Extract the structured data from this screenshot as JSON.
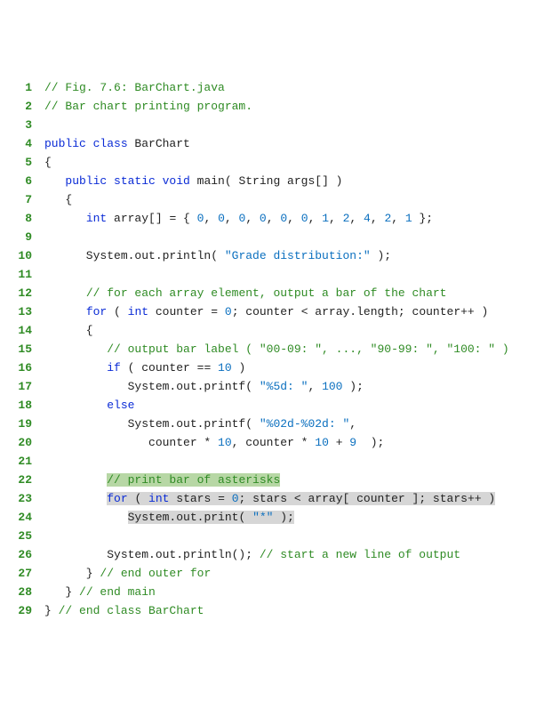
{
  "lines": [
    {
      "n": "1",
      "tokens": [
        {
          "c": "cmt",
          "t": "// Fig. 7.6: BarChart.java"
        }
      ]
    },
    {
      "n": "2",
      "tokens": [
        {
          "c": "cmt",
          "t": "// Bar chart printing program."
        }
      ]
    },
    {
      "n": "3",
      "tokens": [
        {
          "c": "pln",
          "t": ""
        }
      ]
    },
    {
      "n": "4",
      "tokens": [
        {
          "c": "kw",
          "t": "public class "
        },
        {
          "c": "pln",
          "t": "BarChart"
        }
      ]
    },
    {
      "n": "5",
      "tokens": [
        {
          "c": "pln",
          "t": "{"
        }
      ]
    },
    {
      "n": "6",
      "tokens": [
        {
          "c": "pln",
          "t": "   "
        },
        {
          "c": "kw",
          "t": "public static void "
        },
        {
          "c": "pln",
          "t": "main( String args[] )"
        }
      ]
    },
    {
      "n": "7",
      "tokens": [
        {
          "c": "pln",
          "t": "   {"
        }
      ]
    },
    {
      "n": "8",
      "tokens": [
        {
          "c": "pln",
          "t": "      "
        },
        {
          "c": "kw",
          "t": "int "
        },
        {
          "c": "pln",
          "t": "array[] = { "
        },
        {
          "c": "num",
          "t": "0"
        },
        {
          "c": "pln",
          "t": ", "
        },
        {
          "c": "num",
          "t": "0"
        },
        {
          "c": "pln",
          "t": ", "
        },
        {
          "c": "num",
          "t": "0"
        },
        {
          "c": "pln",
          "t": ", "
        },
        {
          "c": "num",
          "t": "0"
        },
        {
          "c": "pln",
          "t": ", "
        },
        {
          "c": "num",
          "t": "0"
        },
        {
          "c": "pln",
          "t": ", "
        },
        {
          "c": "num",
          "t": "0"
        },
        {
          "c": "pln",
          "t": ", "
        },
        {
          "c": "num",
          "t": "1"
        },
        {
          "c": "pln",
          "t": ", "
        },
        {
          "c": "num",
          "t": "2"
        },
        {
          "c": "pln",
          "t": ", "
        },
        {
          "c": "num",
          "t": "4"
        },
        {
          "c": "pln",
          "t": ", "
        },
        {
          "c": "num",
          "t": "2"
        },
        {
          "c": "pln",
          "t": ", "
        },
        {
          "c": "num",
          "t": "1"
        },
        {
          "c": "pln",
          "t": " };"
        }
      ]
    },
    {
      "n": "9",
      "tokens": [
        {
          "c": "pln",
          "t": ""
        }
      ]
    },
    {
      "n": "10",
      "tokens": [
        {
          "c": "pln",
          "t": "      System.out.println( "
        },
        {
          "c": "str",
          "t": "\"Grade distribution:\""
        },
        {
          "c": "pln",
          "t": " );"
        }
      ]
    },
    {
      "n": "11",
      "tokens": [
        {
          "c": "pln",
          "t": ""
        }
      ]
    },
    {
      "n": "12",
      "tokens": [
        {
          "c": "pln",
          "t": "      "
        },
        {
          "c": "cmt",
          "t": "// for each array element, output a bar of the chart"
        }
      ]
    },
    {
      "n": "13",
      "tokens": [
        {
          "c": "pln",
          "t": "      "
        },
        {
          "c": "kw",
          "t": "for "
        },
        {
          "c": "pln",
          "t": "( "
        },
        {
          "c": "kw",
          "t": "int "
        },
        {
          "c": "pln",
          "t": "counter = "
        },
        {
          "c": "num",
          "t": "0"
        },
        {
          "c": "pln",
          "t": "; counter < array.length; counter++ )"
        }
      ]
    },
    {
      "n": "14",
      "tokens": [
        {
          "c": "pln",
          "t": "      {"
        }
      ]
    },
    {
      "n": "15",
      "tokens": [
        {
          "c": "pln",
          "t": "         "
        },
        {
          "c": "cmt",
          "t": "// output bar label ( \"00-09: \", ..., \"90-99: \", \"100: \" )"
        }
      ]
    },
    {
      "n": "16",
      "tokens": [
        {
          "c": "pln",
          "t": "         "
        },
        {
          "c": "kw",
          "t": "if "
        },
        {
          "c": "pln",
          "t": "( counter == "
        },
        {
          "c": "num",
          "t": "10"
        },
        {
          "c": "pln",
          "t": " )"
        }
      ]
    },
    {
      "n": "17",
      "tokens": [
        {
          "c": "pln",
          "t": "            System.out.printf( "
        },
        {
          "c": "str",
          "t": "\"%5d: \""
        },
        {
          "c": "pln",
          "t": ", "
        },
        {
          "c": "num",
          "t": "100"
        },
        {
          "c": "pln",
          "t": " );"
        }
      ]
    },
    {
      "n": "18",
      "tokens": [
        {
          "c": "pln",
          "t": "         "
        },
        {
          "c": "kw",
          "t": "else"
        }
      ]
    },
    {
      "n": "19",
      "tokens": [
        {
          "c": "pln",
          "t": "            System.out.printf( "
        },
        {
          "c": "str",
          "t": "\"%02d-%02d: \""
        },
        {
          "c": "pln",
          "t": ","
        }
      ]
    },
    {
      "n": "20",
      "tokens": [
        {
          "c": "pln",
          "t": "               counter * "
        },
        {
          "c": "num",
          "t": "10"
        },
        {
          "c": "pln",
          "t": ", counter * "
        },
        {
          "c": "num",
          "t": "10"
        },
        {
          "c": "pln",
          "t": " + "
        },
        {
          "c": "num",
          "t": "9"
        },
        {
          "c": "pln",
          "t": "  );"
        }
      ]
    },
    {
      "n": "21",
      "tokens": [
        {
          "c": "pln",
          "t": ""
        }
      ]
    },
    {
      "n": "22",
      "tokens": [
        {
          "c": "pln",
          "t": "         "
        },
        {
          "c": "cmt hlcmt",
          "t": "// print bar of asterisks"
        }
      ]
    },
    {
      "n": "23",
      "tokens": [
        {
          "c": "pln",
          "t": "         "
        },
        {
          "c": "kw hl",
          "t": "for "
        },
        {
          "c": "pln hl",
          "t": "( "
        },
        {
          "c": "kw hl",
          "t": "int "
        },
        {
          "c": "pln hl",
          "t": "stars = "
        },
        {
          "c": "num hl",
          "t": "0"
        },
        {
          "c": "pln hl",
          "t": "; stars < array[ counter ]; stars++ )"
        }
      ]
    },
    {
      "n": "24",
      "tokens": [
        {
          "c": "pln",
          "t": "            "
        },
        {
          "c": "pln hl",
          "t": "System.out.print( "
        },
        {
          "c": "str hl",
          "t": "\"*\""
        },
        {
          "c": "pln hl",
          "t": " );"
        }
      ]
    },
    {
      "n": "25",
      "tokens": [
        {
          "c": "pln",
          "t": ""
        }
      ]
    },
    {
      "n": "26",
      "tokens": [
        {
          "c": "pln",
          "t": "         System.out.println(); "
        },
        {
          "c": "cmt",
          "t": "// start a new line of output"
        }
      ]
    },
    {
      "n": "27",
      "tokens": [
        {
          "c": "pln",
          "t": "      } "
        },
        {
          "c": "cmt",
          "t": "// end outer for"
        }
      ]
    },
    {
      "n": "28",
      "tokens": [
        {
          "c": "pln",
          "t": "   } "
        },
        {
          "c": "cmt",
          "t": "// end main"
        }
      ]
    },
    {
      "n": "29",
      "tokens": [
        {
          "c": "pln",
          "t": "} "
        },
        {
          "c": "cmt",
          "t": "// end class BarChart"
        }
      ]
    }
  ]
}
